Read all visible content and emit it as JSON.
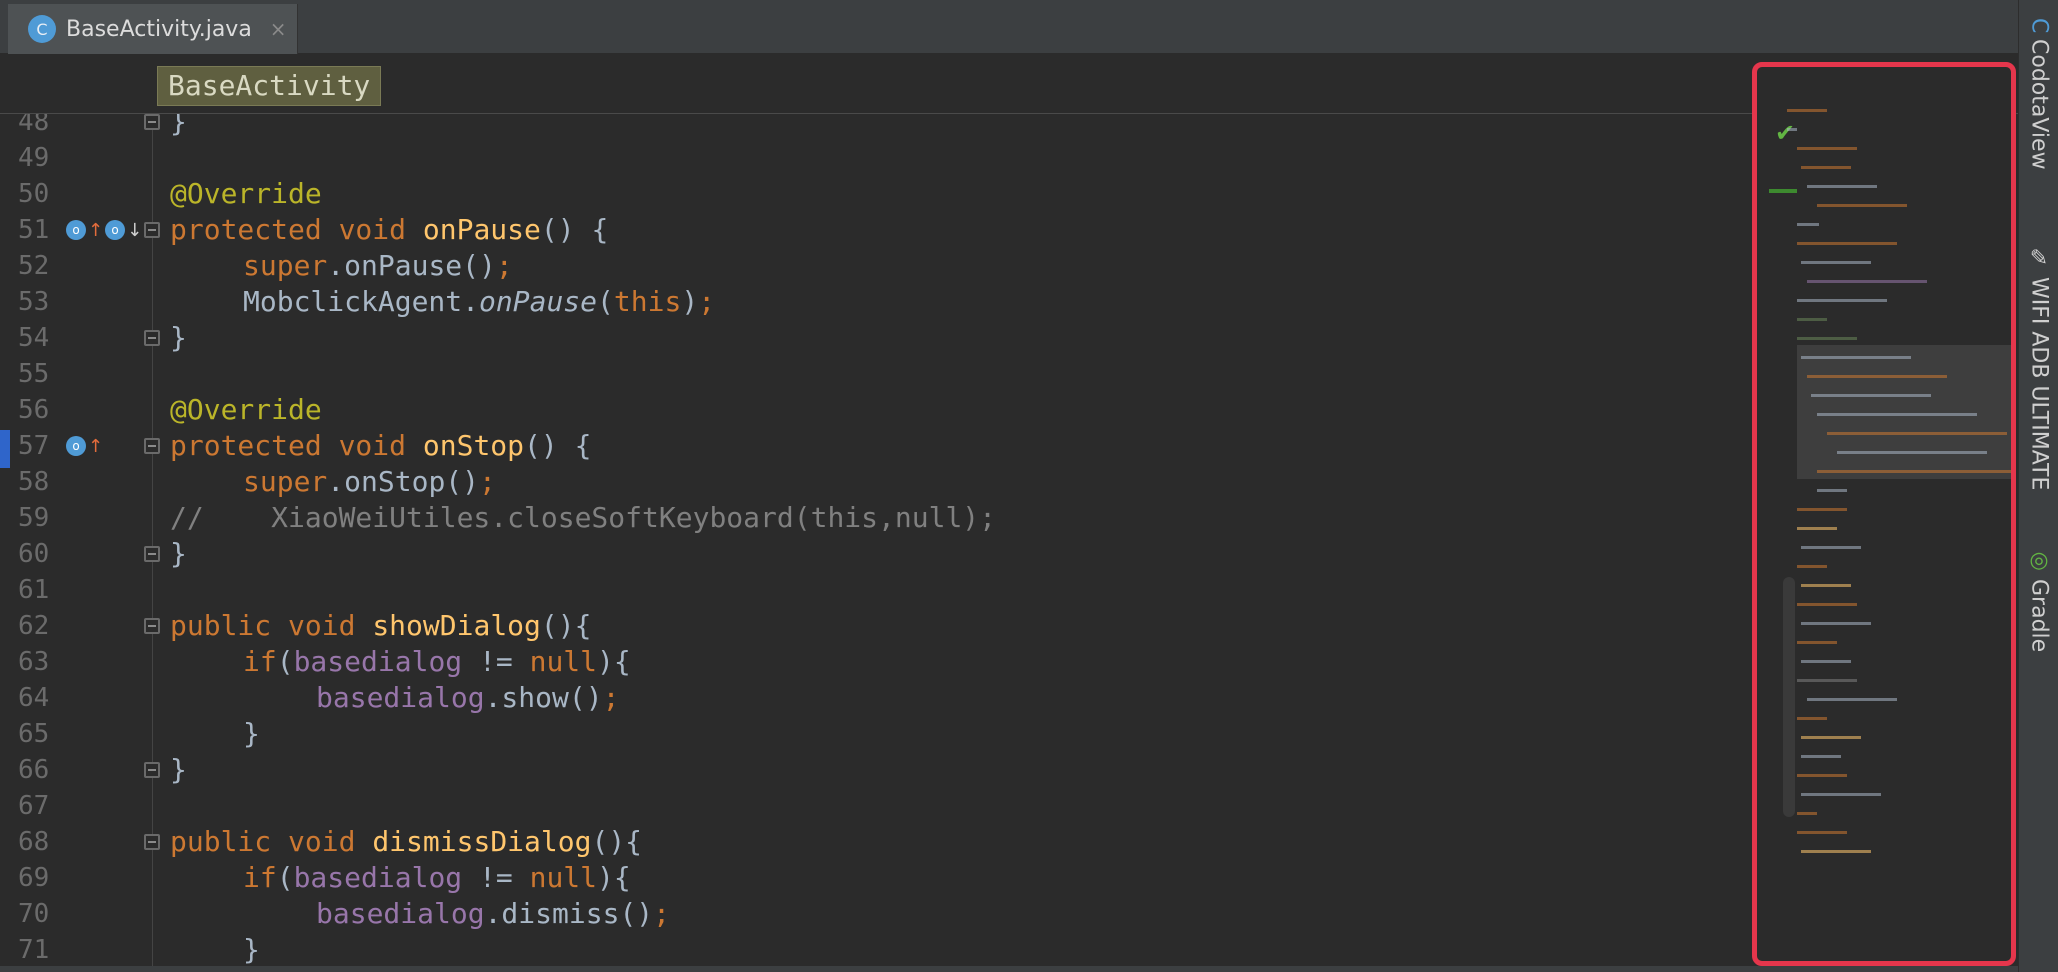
{
  "tab": {
    "icon_letter": "C",
    "filename": "BaseActivity.java",
    "close": "×"
  },
  "breadcrumb": {
    "class_name": "BaseActivity"
  },
  "editor": {
    "lines": [
      {
        "num": "48",
        "tokens": [
          {
            "t": "}",
            "c": ""
          }
        ],
        "indent": 0,
        "fold": true
      },
      {
        "num": "49",
        "tokens": [],
        "indent": 0
      },
      {
        "num": "50",
        "tokens": [
          {
            "t": "@Override",
            "c": "a"
          }
        ],
        "indent": 0
      },
      {
        "num": "51",
        "tokens": [
          {
            "t": "protected ",
            "c": "k"
          },
          {
            "t": "void ",
            "c": "k"
          },
          {
            "t": "onPause",
            "c": "m"
          },
          {
            "t": "() {",
            "c": ""
          }
        ],
        "indent": 0,
        "fold": true,
        "gutter": "up-down"
      },
      {
        "num": "52",
        "tokens": [
          {
            "t": "super",
            "c": "k"
          },
          {
            "t": ".onPause()",
            "c": ""
          },
          {
            "t": ";",
            "c": "k"
          }
        ],
        "indent": 1
      },
      {
        "num": "53",
        "tokens": [
          {
            "t": "MobclickAgent.",
            "c": ""
          },
          {
            "t": "onPause",
            "c": "i"
          },
          {
            "t": "(",
            "c": ""
          },
          {
            "t": "this",
            "c": "k"
          },
          {
            "t": ")",
            "c": ""
          },
          {
            "t": ";",
            "c": "k"
          }
        ],
        "indent": 1
      },
      {
        "num": "54",
        "tokens": [
          {
            "t": "}",
            "c": ""
          }
        ],
        "indent": 0,
        "fold": true
      },
      {
        "num": "55",
        "tokens": [],
        "indent": 0
      },
      {
        "num": "56",
        "tokens": [
          {
            "t": "@Override",
            "c": "a"
          }
        ],
        "indent": 0
      },
      {
        "num": "57",
        "tokens": [
          {
            "t": "protected ",
            "c": "k"
          },
          {
            "t": "void ",
            "c": "k"
          },
          {
            "t": "onStop",
            "c": "m"
          },
          {
            "t": "() {",
            "c": ""
          }
        ],
        "indent": 0,
        "fold": true,
        "gutter": "up"
      },
      {
        "num": "58",
        "tokens": [
          {
            "t": "super",
            "c": "k"
          },
          {
            "t": ".onStop()",
            "c": ""
          },
          {
            "t": ";",
            "c": "k"
          }
        ],
        "indent": 1
      },
      {
        "num": "59",
        "tokens": [
          {
            "t": "//    XiaoWeiUtiles.closeSoftKeyboard(this,null);",
            "c": "c"
          }
        ],
        "indent": 0
      },
      {
        "num": "60",
        "tokens": [
          {
            "t": "}",
            "c": ""
          }
        ],
        "indent": 0,
        "fold": true
      },
      {
        "num": "61",
        "tokens": [],
        "indent": 0
      },
      {
        "num": "62",
        "tokens": [
          {
            "t": "public ",
            "c": "k"
          },
          {
            "t": "void ",
            "c": "k"
          },
          {
            "t": "showDialog",
            "c": "m"
          },
          {
            "t": "(){",
            "c": ""
          }
        ],
        "indent": 0,
        "fold": true
      },
      {
        "num": "63",
        "tokens": [
          {
            "t": "if",
            "c": "k"
          },
          {
            "t": "(",
            "c": ""
          },
          {
            "t": "basedialog",
            "c": "f"
          },
          {
            "t": " != ",
            "c": ""
          },
          {
            "t": "null",
            "c": "k"
          },
          {
            "t": "){",
            "c": ""
          }
        ],
        "indent": 1
      },
      {
        "num": "64",
        "tokens": [
          {
            "t": "basedialog",
            "c": "f"
          },
          {
            "t": ".show()",
            "c": ""
          },
          {
            "t": ";",
            "c": "k"
          }
        ],
        "indent": 2
      },
      {
        "num": "65",
        "tokens": [
          {
            "t": "}",
            "c": ""
          }
        ],
        "indent": 1
      },
      {
        "num": "66",
        "tokens": [
          {
            "t": "}",
            "c": ""
          }
        ],
        "indent": 0,
        "fold": true
      },
      {
        "num": "67",
        "tokens": [],
        "indent": 0
      },
      {
        "num": "68",
        "tokens": [
          {
            "t": "public ",
            "c": "k"
          },
          {
            "t": "void ",
            "c": "k"
          },
          {
            "t": "dismissDialog",
            "c": "m"
          },
          {
            "t": "(){",
            "c": ""
          }
        ],
        "indent": 0,
        "fold": true
      },
      {
        "num": "69",
        "tokens": [
          {
            "t": "if",
            "c": "k"
          },
          {
            "t": "(",
            "c": ""
          },
          {
            "t": "basedialog",
            "c": "f"
          },
          {
            "t": " != ",
            "c": ""
          },
          {
            "t": "null",
            "c": "k"
          },
          {
            "t": "){",
            "c": ""
          }
        ],
        "indent": 1
      },
      {
        "num": "70",
        "tokens": [
          {
            "t": "basedialog",
            "c": "f"
          },
          {
            "t": ".dismiss()",
            "c": ""
          },
          {
            "t": ";",
            "c": "k"
          }
        ],
        "indent": 2
      },
      {
        "num": "71",
        "tokens": [
          {
            "t": "}",
            "c": ""
          }
        ],
        "indent": 1
      }
    ]
  },
  "right_tools": [
    {
      "label": "CodotaView",
      "icon": "codota-icon",
      "glyph": "C",
      "color": "#4f9bd6"
    },
    {
      "label": "WIFI ADB ULTIMATE",
      "icon": "usb-icon",
      "glyph": "✎",
      "color": "#cfcfcf"
    },
    {
      "label": "Gradle",
      "icon": "gradle-icon",
      "glyph": "◎",
      "color": "#62b543"
    }
  ],
  "colors": {
    "keyword": "#cc7832",
    "annotation": "#bbb529",
    "method": "#ffc66d",
    "field": "#9876aa",
    "comment": "#808080",
    "highlight_border": "#e5364c"
  }
}
